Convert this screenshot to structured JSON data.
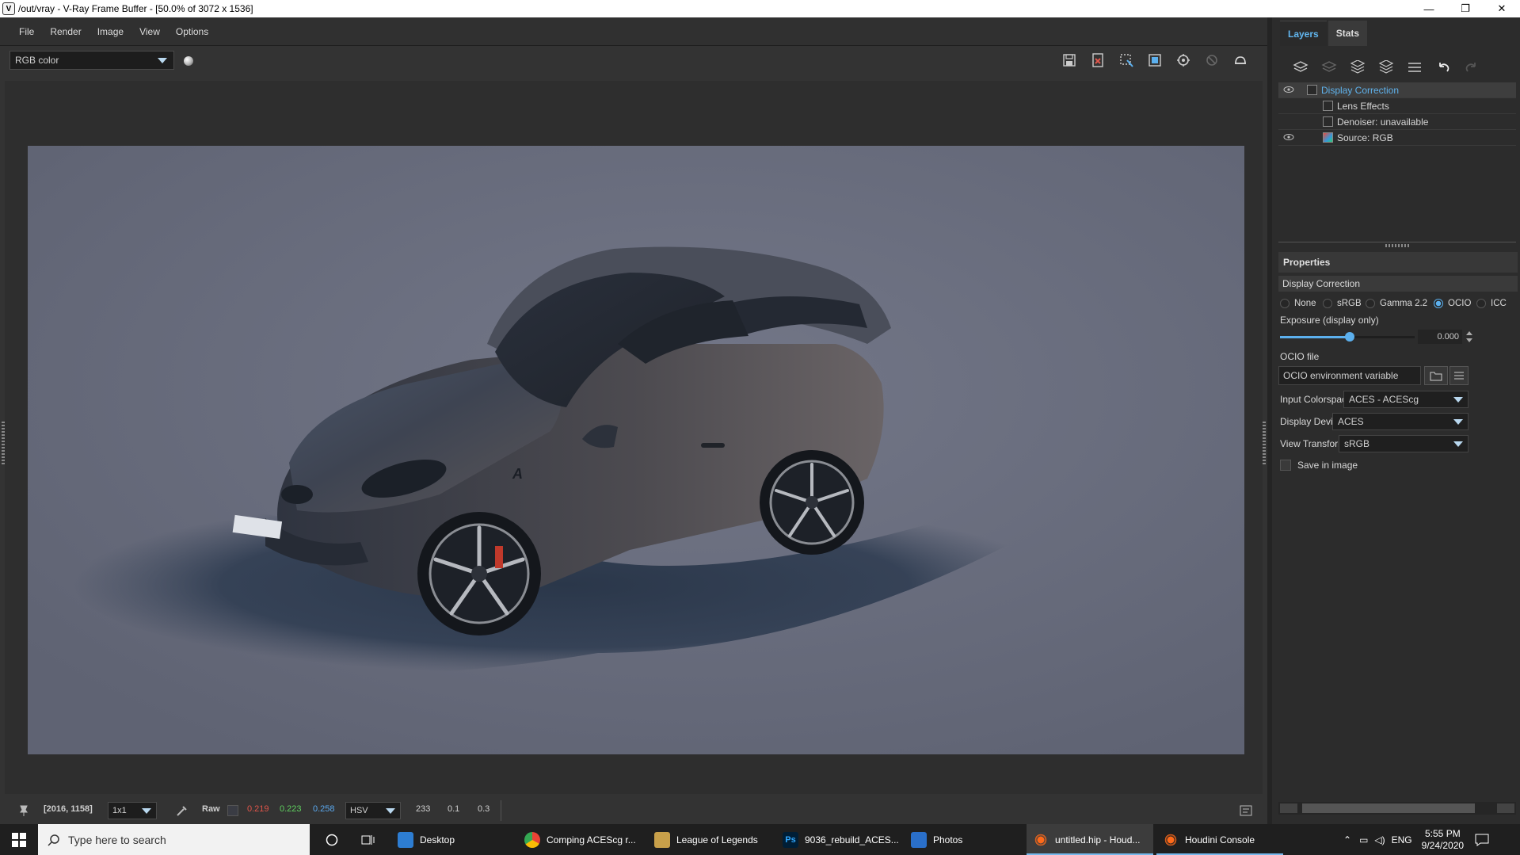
{
  "window": {
    "title": "/out/vray - V-Ray Frame Buffer - [50.0% of 3072 x 1536]",
    "minimize": "—",
    "maximize": "❐",
    "close": "✕"
  },
  "menu": [
    "File",
    "Render",
    "Image",
    "View",
    "Options"
  ],
  "toolbar": {
    "channel": "RGB color",
    "icons": [
      "save-icon",
      "clear-image-icon",
      "region-render-icon",
      "track-mouse-icon",
      "interactive-render-icon",
      "stop-render-icon",
      "render-icon"
    ]
  },
  "statusbar": {
    "coords": "[2016, 1158]",
    "sample_size": "1x1",
    "mode": "Raw",
    "r": "0.219",
    "g": "0.223",
    "b": "0.258",
    "colorspace": "HSV",
    "h": "233",
    "s": "0.1",
    "v": "0.3"
  },
  "rightpanel": {
    "tabs": [
      "Layers",
      "Stats"
    ],
    "layers": [
      {
        "label": "Display Correction",
        "visible": true,
        "selected": true
      },
      {
        "label": "Lens Effects",
        "visible": false,
        "selected": false
      },
      {
        "label": "Denoiser: unavailable",
        "visible": false,
        "selected": false
      },
      {
        "label": "Source: RGB",
        "visible": true,
        "selected": false
      }
    ],
    "properties": {
      "header": "Properties",
      "section": "Display Correction",
      "modes": [
        "None",
        "sRGB",
        "Gamma 2.2",
        "OCIO",
        "ICC"
      ],
      "selected_mode": "OCIO",
      "exposure_label": "Exposure (display only)",
      "exposure_value": "0.000",
      "ocio_file_label": "OCIO file",
      "ocio_file_value": "OCIO environment variable",
      "input_colorspace_label": "Input Colorspace",
      "input_colorspace_value": "ACES - ACEScg",
      "display_device_label": "Display Device",
      "display_device_value": "ACES",
      "view_transform_label": "View Transform",
      "view_transform_value": "sRGB",
      "save_in_image_label": "Save in image"
    }
  },
  "taskbar": {
    "search_placeholder": "Type here to search",
    "items": [
      {
        "label": "Desktop",
        "color": "#2d7dd2"
      },
      {
        "label": "Comping ACEScg r...",
        "color": "#e8b52f"
      },
      {
        "label": "League of Legends",
        "color": "#c8a04a"
      },
      {
        "label": "9036_rebuild_ACES...",
        "color": "#31a8ff"
      },
      {
        "label": "Photos",
        "color": "#2a6fc9"
      },
      {
        "label": "untitled.hip - Houd...",
        "color": "#ff6a1a"
      },
      {
        "label": "Houdini Console",
        "color": "#ff6a1a"
      }
    ],
    "lang": "ENG",
    "time": "5:55 PM",
    "date": "9/24/2020"
  }
}
